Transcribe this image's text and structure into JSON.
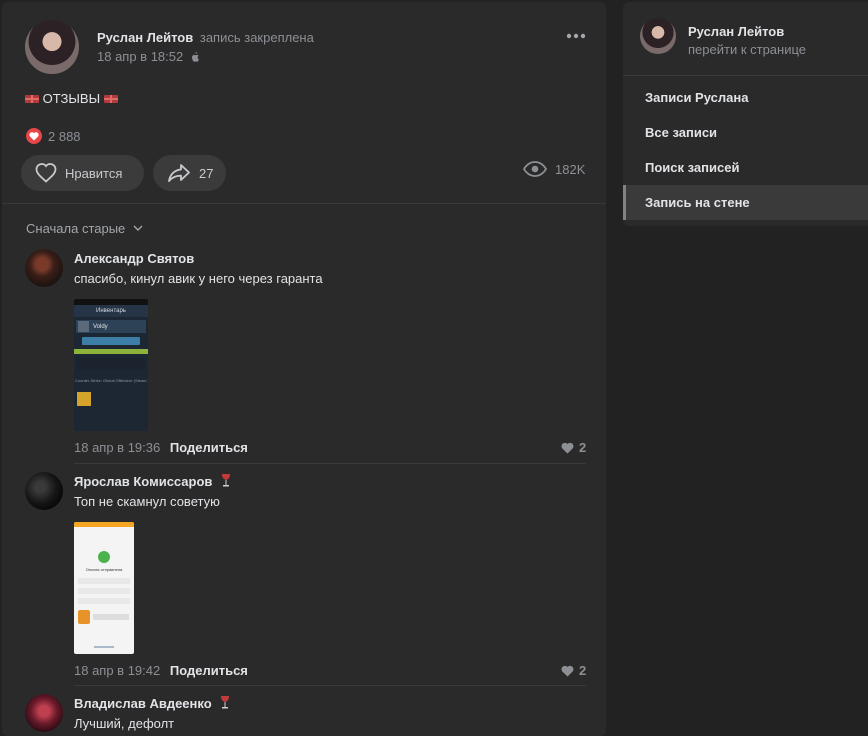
{
  "post": {
    "author": "Руслан Лейтов",
    "pinned_label": "запись закреплена",
    "date": "18 апр в 18:52",
    "text": "ОТЗЫВЫ",
    "likes_count": "2 888",
    "like_button_label": "Нравится",
    "share_count": "27",
    "views": "182K"
  },
  "comments_header": {
    "sort_label": "Сначала старые"
  },
  "comments": [
    {
      "author": "Александр Святов",
      "text": "спасибо, кинул авик у него через гаранта",
      "date": "18 апр в 19:36",
      "reply_label": "Поделиться",
      "likes": "2",
      "attachment": {
        "title": "Инвентарь",
        "profile": "Voldy",
        "section": "Counter-Strike: Global Offensive (Steam)"
      }
    },
    {
      "author": "Ярослав Комиссаров",
      "text": "Топ не скамнул советую",
      "date": "18 апр в 19:42",
      "reply_label": "Поделиться",
      "likes": "2",
      "attachment": {
        "title": "Оплата отправлена"
      }
    },
    {
      "author": "Владислав Авдеенко",
      "text": "Лучший, дефолт"
    }
  ],
  "sidebar": {
    "profile_name": "Руслан Лейтов",
    "profile_link": "перейти к странице",
    "menu": [
      {
        "label": "Записи Руслана",
        "active": false
      },
      {
        "label": "Все записи",
        "active": false
      },
      {
        "label": "Поиск записей",
        "active": false
      },
      {
        "label": "Запись на стене",
        "active": true
      }
    ]
  },
  "colors": {
    "page_bg": "#222222",
    "card_bg": "#2a2a2b",
    "button_bg": "#3b3b3c",
    "like_red": "#e64646",
    "text_primary": "#e1e3e6",
    "text_secondary": "#8c8f94"
  }
}
